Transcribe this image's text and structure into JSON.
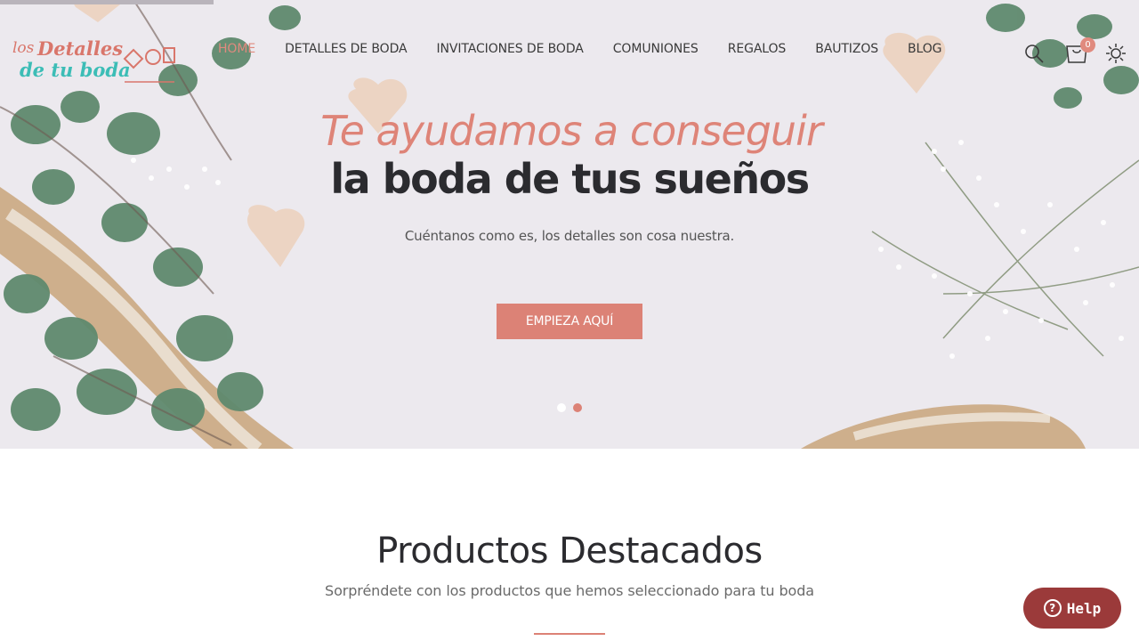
{
  "logo": {
    "line1_small": "los",
    "line1": "Detalles",
    "line2": "de tu boda"
  },
  "nav": {
    "items": [
      {
        "label": "HOME",
        "active": true
      },
      {
        "label": "DETALLES DE BODA"
      },
      {
        "label": "INVITACIONES DE BODA"
      },
      {
        "label": "COMUNIONES"
      },
      {
        "label": "REGALOS"
      },
      {
        "label": "BAUTIZOS"
      },
      {
        "label": "BLOG"
      }
    ]
  },
  "header": {
    "cart_count": "0",
    "icons": [
      "search-icon",
      "cart-icon",
      "gear-icon"
    ]
  },
  "hero": {
    "title_line1": "Te ayudamos a conseguir",
    "title_line2": "la boda de tus sueños",
    "subtitle": "Cuéntanos como es, los detalles son cosa nuestra.",
    "cta_label": "EMPIEZA AQUÍ",
    "slides": 2,
    "active_slide": 2
  },
  "featured": {
    "title": "Productos Destacados",
    "subtitle": "Sorpréndete con los productos que hemos seleccionado para tu boda"
  },
  "help": {
    "label": "Help"
  },
  "colors": {
    "accent": "#dc8276",
    "teal": "#3cbdb6",
    "dark": "#2b2b2f",
    "help": "#9b3a3a"
  }
}
